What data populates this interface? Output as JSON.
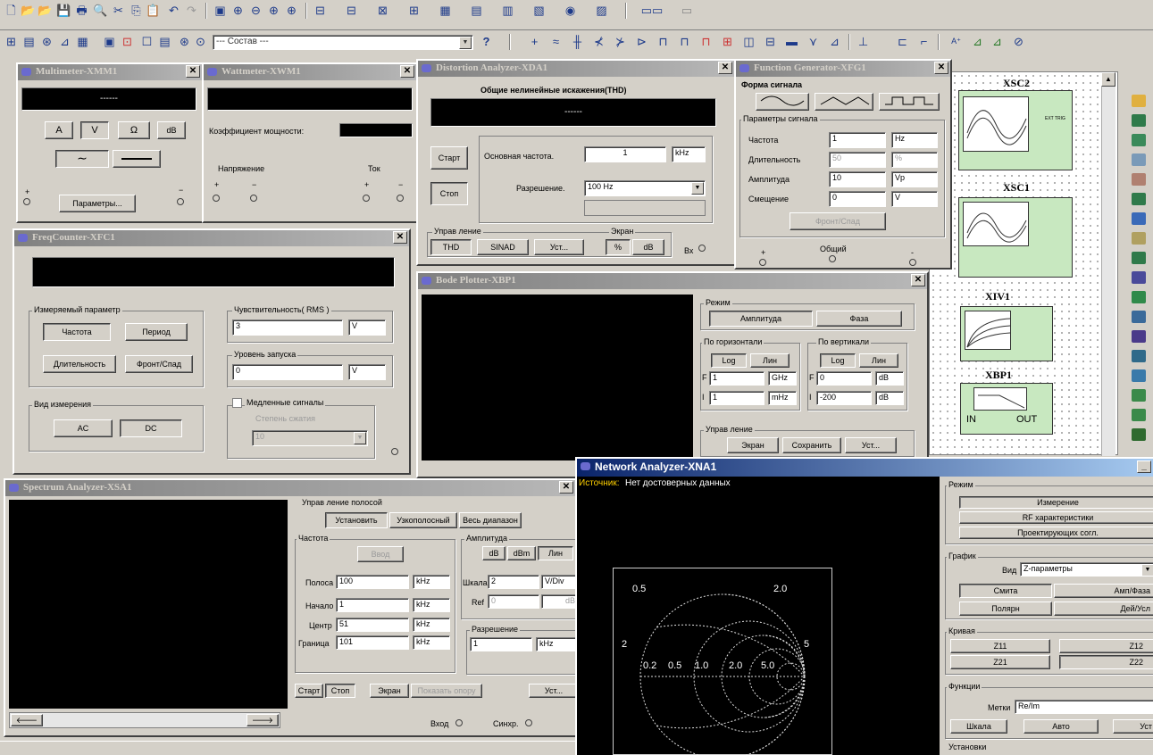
{
  "toolbar": {
    "component_select": "--- Состав ---",
    "help": "?"
  },
  "multimeter": {
    "title": "Multimeter-XMM1",
    "display": "------",
    "modes": [
      "A",
      "V",
      "Ω",
      "dB"
    ],
    "params": "Параметры..."
  },
  "wattmeter": {
    "title": "Wattmeter-XWM1",
    "pf_label": "Коэффициент мощности:",
    "voltage": "Напряжение",
    "current": "Ток"
  },
  "distortion": {
    "title": "Distortion Analyzer-XDA1",
    "header": "Общие нелинейные искажения(THD)",
    "display": "------",
    "start": "Старт",
    "stop": "Стоп",
    "fund_label": "Основная частота.",
    "fund_val": "1",
    "fund_unit": "kHz",
    "res_label": "Разрешение.",
    "res_val": "100 Hz",
    "control": "Управ ление",
    "thd": "THD",
    "sinad": "SINAD",
    "set": "Уст...",
    "screen": "Экран",
    "pct": "%",
    "db": "dB",
    "in": "Вх"
  },
  "funcgen": {
    "title": "Function Generator-XFG1",
    "waveform": "Форма сигнала",
    "params": "Параметры сигнала",
    "rows": [
      {
        "label": "Частота",
        "val": "1",
        "unit": "Hz"
      },
      {
        "label": "Длительность",
        "val": "50",
        "unit": "%"
      },
      {
        "label": "Амплитуда",
        "val": "10",
        "unit": "Vp"
      },
      {
        "label": "Смещение",
        "val": "0",
        "unit": "V"
      }
    ],
    "edge": "Фронт/Спад",
    "common": "Общий",
    "plus": "+",
    "minus": "-"
  },
  "freq": {
    "title": "FreqCounter-XFC1",
    "meas_param": "Измеряемый параметр",
    "freq_btn": "Частота",
    "period_btn": "Период",
    "dur_btn": "Длительность",
    "edge_btn": "Фронт/Спад",
    "coupling": "Вид измерения",
    "ac": "AC",
    "dc": "DC",
    "sens": "Чувствительность( RMS )",
    "sens_val": "3",
    "sens_unit": "V",
    "trig": "Уровень запуска",
    "trig_val": "0",
    "trig_unit": "V",
    "slow": "Медленные сигналы",
    "deg": "Степень сжатия",
    "deg_val": "10"
  },
  "bode": {
    "title": "Bode Plotter-XBP1",
    "mode": "Режим",
    "mag": "Амплитуда",
    "phase": "Фаза",
    "horiz": "По горизонтали",
    "vert": "По вертикали",
    "log": "Log",
    "lin": "Лин",
    "hF": "1",
    "hFu": "GHz",
    "hI": "1",
    "hIu": "mHz",
    "vF": "0",
    "vFu": "dB",
    "vI": "-200",
    "vIu": "dB",
    "control": "Управ ление",
    "screen": "Экран",
    "save": "Сохранить",
    "set": "Уст..."
  },
  "spectrum": {
    "title": "Spectrum Analyzer-XSA1",
    "band": "Управ ление полосой",
    "set_btn": "Установить",
    "narrow": "Узкополосный",
    "full": "Весь диапазон",
    "freq": "Частота",
    "enter": "Ввод",
    "rows": [
      {
        "label": "Полоса",
        "val": "100",
        "unit": "kHz"
      },
      {
        "label": "Начало",
        "val": "1",
        "unit": "kHz"
      },
      {
        "label": "Центр",
        "val": "51",
        "unit": "kHz"
      },
      {
        "label": "Граница",
        "val": "101",
        "unit": "kHz"
      }
    ],
    "amp": "Амплитуда",
    "db": "dB",
    "dbm": "dBm",
    "lin": "Лин",
    "scale": "Шкала",
    "scale_val": "2",
    "scale_unit": "V/Div",
    "ref": "Ref",
    "ref_val": "0",
    "ref_unit": "dB",
    "res": "Разрешение",
    "res_val": "1",
    "res_unit": "kHz",
    "start": "Старт",
    "stop": "Стоп",
    "screen": "Экран",
    "show_ref": "Показать опору",
    "set": "Уст...",
    "in": "Вход",
    "trig": "Синхр."
  },
  "network": {
    "title": "Network Analyzer-XNA1",
    "source_lbl": "Источник:",
    "source_val": "Нет достоверных данных",
    "mode": "Режим",
    "measure": "Измерение",
    "rf": "RF характеристики",
    "match": "Проектирующих согл.",
    "graph": "График",
    "view": "Вид",
    "view_val": "Z-параметры",
    "smith": "Смита",
    "magph": "Амп/Фаза",
    "polar": "Полярн",
    "reim": "Дей/Усл",
    "curves": "Кривая",
    "z11": "Z11",
    "z12": "Z12",
    "z21": "Z21",
    "z22": "Z22",
    "func": "Функции",
    "marker": "Метки",
    "marker_val": "Re/Im",
    "scale": "Шкала",
    "auto": "Авто",
    "set": "Уст",
    "settings": "Установки",
    "smith_labels": [
      "0.5",
      "2.0",
      "0.2",
      "0.5",
      "1.0",
      "2.0",
      "5.0",
      "5",
      "2"
    ]
  },
  "instruments": {
    "xsc2": "XSC2",
    "xsc1": "XSC1",
    "xiv1": "XIV1",
    "xbp1": "XBP1",
    "in": "IN",
    "out": "OUT"
  }
}
